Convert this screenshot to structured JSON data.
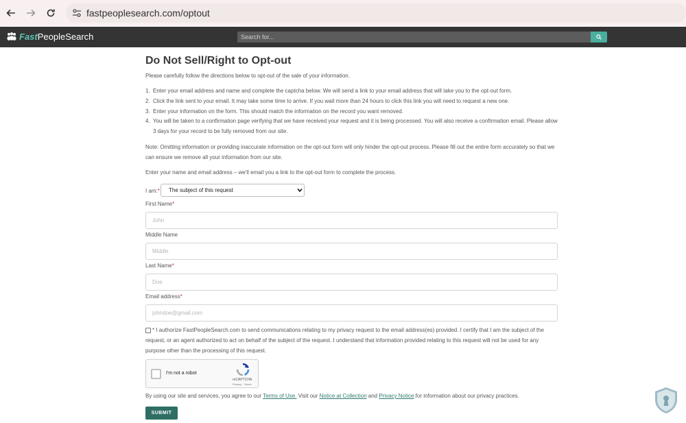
{
  "browser": {
    "url": "fastpeoplesearch.com/optout"
  },
  "site": {
    "logo_fast": "Fast",
    "logo_rest": "PeopleSearch",
    "search_placeholder": "Search for..."
  },
  "page": {
    "title": "Do Not Sell/Right to Opt-out",
    "intro": "Please carefully follow the directions below to opt-out of the sale of your information.",
    "steps": [
      {
        "num": "1.",
        "text": "Enter your email address and name and complete the captcha below. We will send a link to your email address that will take you to the opt-out form."
      },
      {
        "num": "2.",
        "text": "Click the link sent to your email. It may take some time to arrive. If you wait more than 24 hours to click this link you will need to request a new one."
      },
      {
        "num": "3.",
        "text": "Enter your information on the form. This should match the information on the record you want removed."
      },
      {
        "num": "4.",
        "text": "You will be taken to a confirmation page verifying that we have received your request and it is being processed. You will also receive a confirmation email. Please allow 3 days for your record to be fully removed from our site."
      }
    ],
    "note": "Note: Omitting information or providing inaccurate information on the opt-out form will only hinder the opt-out process. Please fill out the entire form accurately so that we can ensure we remove all your information from our site.",
    "enter_line": "Enter your name and email address – we'll email you a link to the opt-out form to complete the process."
  },
  "form": {
    "iam_label": "I am:",
    "iam_value": "The subject of this request",
    "required_mark": "*",
    "first_name": {
      "label": "First Name",
      "placeholder": "John"
    },
    "middle_name": {
      "label": "Middle Name",
      "placeholder": "Middle"
    },
    "last_name": {
      "label": "Last Name",
      "placeholder": "Doe"
    },
    "email": {
      "label": "Email address",
      "placeholder": "johndoe@gmail.com"
    },
    "consent": "* I authorize FastPeopleSearch.com to send communications relating to my privacy request to the email address(es) provided. I certify that I am the subject of the request, or an agent authorized to act on behalf of the subject of the request. I understand that information provided relating to this request will not be used for any purpose other than the processing of this request.",
    "captcha": {
      "label": "I'm not a robot",
      "brand": "reCAPTCHA",
      "links": "Privacy - Terms"
    },
    "terms": {
      "pre": "By using our site and services, you agree to our ",
      "terms_link": "Terms of Use.",
      "mid1": " Visit our ",
      "notice_link": "Notice at Collection",
      "mid2": " and ",
      "privacy_link": "Privacy Notice",
      "post": " for information about our privacy practices."
    },
    "submit": "SUBMIT"
  },
  "colors": {
    "accent": "#2f6e63",
    "search_button": "#4aaf9f",
    "header_bg": "#343434"
  }
}
